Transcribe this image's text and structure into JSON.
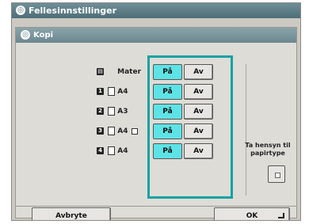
{
  "window": {
    "title": "Fellesinnstillinger"
  },
  "dialog": {
    "title": "Kopi"
  },
  "rows": [
    {
      "num": "",
      "label": "Mater",
      "on": "På",
      "off": "Av",
      "selected": "on",
      "tray_icon": "feeder-icon"
    },
    {
      "num": "1",
      "label": "A4",
      "on": "På",
      "off": "Av",
      "selected": "on"
    },
    {
      "num": "2",
      "label": "A3",
      "on": "På",
      "off": "Av",
      "selected": "on"
    },
    {
      "num": "3",
      "label": "A4",
      "on": "På",
      "off": "Av",
      "selected": "on"
    },
    {
      "num": "4",
      "label": "A4",
      "on": "På",
      "off": "Av",
      "selected": "on"
    }
  ],
  "paper_type": {
    "label": "Ta hensyn til papirtype"
  },
  "footer": {
    "cancel": "Avbryte",
    "ok": "OK"
  },
  "colors": {
    "selected": "#5de3e6",
    "frame": "#12a3a3",
    "title_bar": "#4e6d77"
  }
}
